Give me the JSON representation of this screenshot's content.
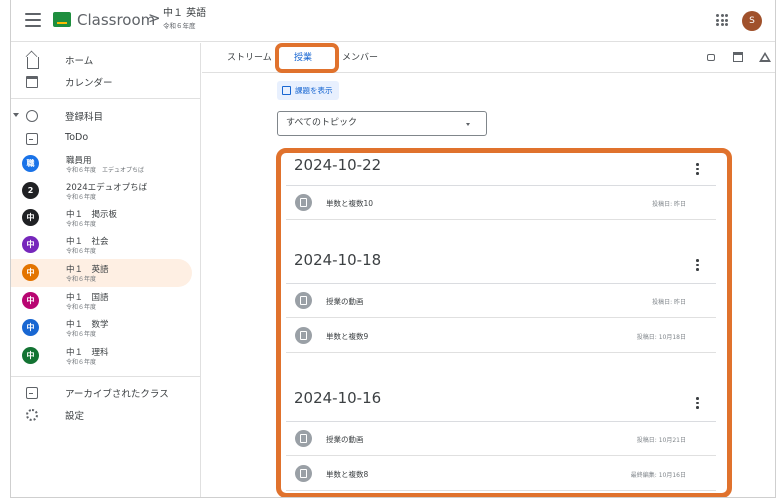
{
  "header": {
    "app_title": "Classroom",
    "breadcrumb_arrow": ">",
    "class_name": "中１ 英語",
    "class_sub": "令和６年度",
    "avatar_letter": "S",
    "avatar_color": "#a0512b"
  },
  "sidebar": {
    "home": "ホーム",
    "calendar": "カレンダー",
    "enrolled": "登録科目",
    "todo": "ToDo",
    "courses": [
      {
        "initial": "職",
        "name": "職員用",
        "sub": "令和６年度　エデュオプちば",
        "color": "#1a73e8"
      },
      {
        "initial": "2",
        "name": "2024エデュオプちば",
        "sub": "令和６年度",
        "color": "#202124"
      },
      {
        "initial": "中",
        "name": "中１　掲示板",
        "sub": "令和６年度",
        "color": "#202124"
      },
      {
        "initial": "中",
        "name": "中１　社会",
        "sub": "令和６年度",
        "color": "#7627bb"
      },
      {
        "initial": "中",
        "name": "中１　英語",
        "sub": "令和６年度",
        "color": "#e37400"
      },
      {
        "initial": "中",
        "name": "中１　国語",
        "sub": "令和６年度",
        "color": "#b80672"
      },
      {
        "initial": "中",
        "name": "中１　数学",
        "sub": "令和６年度",
        "color": "#1967d2"
      },
      {
        "initial": "中",
        "name": "中１　理科",
        "sub": "令和６年度",
        "color": "#137333"
      }
    ],
    "archived": "アーカイブされたクラス",
    "settings": "設定"
  },
  "tabs": {
    "stream": "ストリーム",
    "classwork": "授業",
    "people": "メンバー"
  },
  "view_assignments": "課題を表示",
  "topic_filter": "すべてのトピック",
  "topics": [
    {
      "title": "2024-10-22",
      "items": [
        {
          "name": "単数と複数10",
          "date": "投稿日: 昨日"
        }
      ]
    },
    {
      "title": "2024-10-18",
      "items": [
        {
          "name": "授業の動画",
          "date": "投稿日: 昨日"
        },
        {
          "name": "単数と複数9",
          "date": "投稿日: 10月18日"
        }
      ]
    },
    {
      "title": "2024-10-16",
      "items": [
        {
          "name": "授業の動画",
          "date": "投稿日: 10月21日"
        },
        {
          "name": "単数と複数8",
          "date": "最終編集: 10月16日"
        }
      ]
    }
  ],
  "highlight_color": "#e0722d"
}
